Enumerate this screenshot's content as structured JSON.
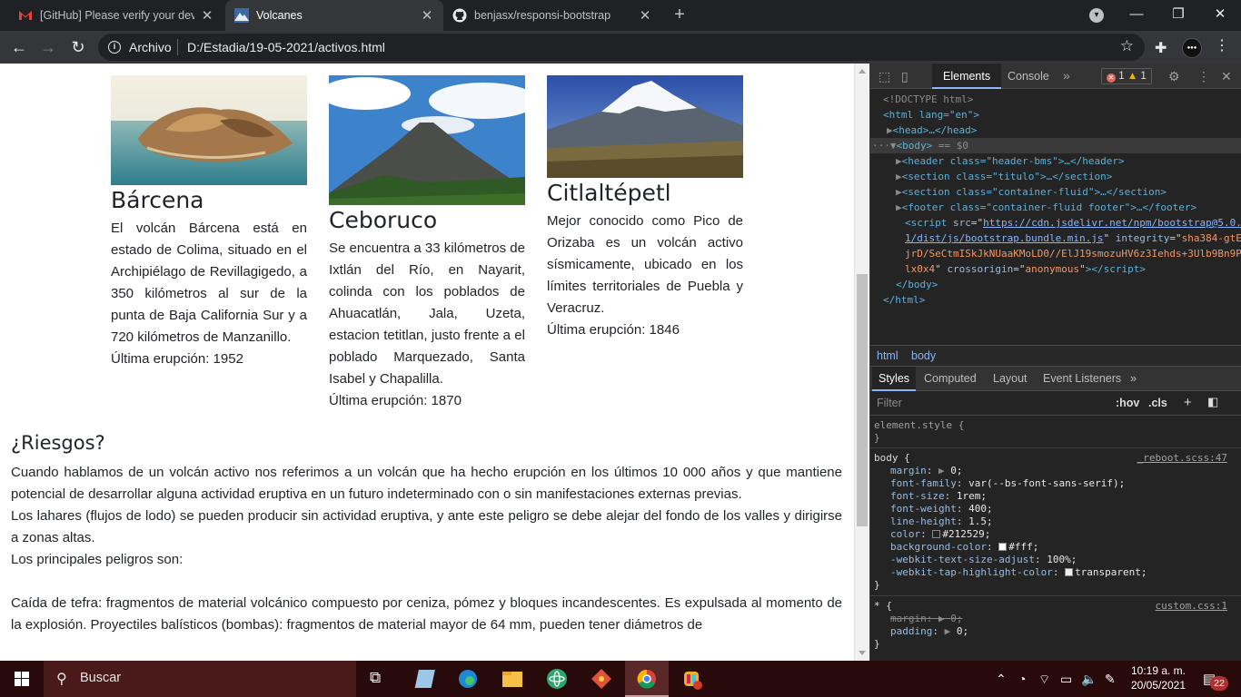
{
  "browser": {
    "tabs": [
      {
        "title": "[GitHub] Please verify your device",
        "close": "✕"
      },
      {
        "title": "Volcanes",
        "close": "✕"
      },
      {
        "title": "benjasx/responsi-bootstrap",
        "close": "✕"
      }
    ],
    "new_tab": "+",
    "address": {
      "scheme": "Archivo",
      "url": "D:/Estadia/19-05-2021/activos.html"
    }
  },
  "page": {
    "cards": [
      {
        "name": "Bárcena",
        "description": "El volcán Bárcena está en estado de Colima, situado en el Archipiélago de Revillagigedo, a 350 kilómetros al sur de la punta de Baja California Sur y a 720 kilómetros de Manzanillo.",
        "eruption": "Última erupción: 1952"
      },
      {
        "name": "Ceboruco",
        "description": "Se encuentra a 33 kilómetros de Ixtlán del Río, en Nayarit, colinda con los poblados de Ahuacatlán, Jala, Uzeta, estacion tetitlan, justo frente a el poblado Marquezado, Santa Isabel y Chapalilla.",
        "eruption": "Última erupción: 1870"
      },
      {
        "name": "Citlaltépetl",
        "description": "Mejor conocido como Pico de Orizaba es un volcán activo sísmicamente, ubicado en los límites territoriales de Puebla y Veracruz.",
        "eruption": "Última erupción: 1846"
      }
    ],
    "riesgos": {
      "heading": "¿Riesgos?",
      "p1": "Cuando hablamos de un volcán activo nos referimos a un volcán que ha hecho erupción en los últimos 10 000 años y que mantiene potencial de desarrollar alguna actividad eruptiva en un futuro indeterminado con o sin manifestaciones externas previas.",
      "p2": "Los lahares (flujos de lodo) se pueden producir sin actividad eruptiva, y ante este peligro se debe alejar del fondo de los valles y dirigirse a zonas altas.",
      "p3": "Los principales peligros son:",
      "p4": "Caída de tefra: fragmentos de material volcánico compuesto por ceniza, pómez y bloques incandescentes. Es expulsada al momento de la explosión. Proyectiles balísticos (bombas): fragmentos de material mayor de 64 mm, pueden tener diámetros de"
    }
  },
  "devtools": {
    "tabs": {
      "elements": "Elements",
      "console": "Console"
    },
    "errors": "1",
    "warnings": "1",
    "dom": {
      "doctype": "<!DOCTYPE html>",
      "html_open": "<html lang=\"en\">",
      "head": "<head>…</head>",
      "body_suffix": "== $0",
      "header": "<header class=\"header-bms\">…</header>",
      "section_titulo": "<section class=\"titulo\">…</section>",
      "section_container": "<section class=\"container-fluid\">…</section>",
      "footer": "<footer class=\"container-fluid footer\">…</footer>",
      "script_src": "https://cdn.jsdelivr.net/npm/bootstrap@5.0.1/dist/js/bootstrap.bundle.min.js",
      "script_integrity": "sha384-gtEjrD/SeCtmISkJkNUaaKMoLD0//ElJ19smozuHV6z3Iehds+3Ulb9Bn9Plx0x4",
      "script_crossorigin": "anonymous",
      "body_close": "</body>",
      "html_close": "</html>"
    },
    "breadcrumbs": [
      "html",
      "body"
    ],
    "styles_tabs": [
      "Styles",
      "Computed",
      "Layout",
      "Event Listeners"
    ],
    "filter_placeholder": "Filter",
    "filter_hov": ":hov",
    "filter_cls": ".cls",
    "element_style": "element.style {",
    "body_rule": {
      "selector": "body {",
      "source": "_reboot.scss:47",
      "props": [
        {
          "name": "margin",
          "value": "0;"
        },
        {
          "name": "font-family",
          "value": "var(--bs-font-sans-serif);"
        },
        {
          "name": "font-size",
          "value": "1rem;"
        },
        {
          "name": "font-weight",
          "value": "400;"
        },
        {
          "name": "line-height",
          "value": "1.5;"
        },
        {
          "name": "color",
          "value": "#212529;"
        },
        {
          "name": "background-color",
          "value": "#fff;"
        },
        {
          "name": "-webkit-text-size-adjust",
          "value": "100%;"
        },
        {
          "name": "-webkit-tap-highlight-color",
          "value": "transparent;"
        }
      ]
    },
    "star_rule": {
      "selector": "* {",
      "source": "custom.css:1",
      "props": [
        {
          "name": "margin",
          "value": "0;"
        },
        {
          "name": "padding",
          "value": "0;"
        }
      ]
    }
  },
  "taskbar": {
    "search": "Buscar",
    "time": "10:19 a. m.",
    "date": "20/05/2021",
    "notifications": "22"
  },
  "colors": {
    "accent": "#8ab4f8",
    "taskbar": "#280a0a"
  }
}
